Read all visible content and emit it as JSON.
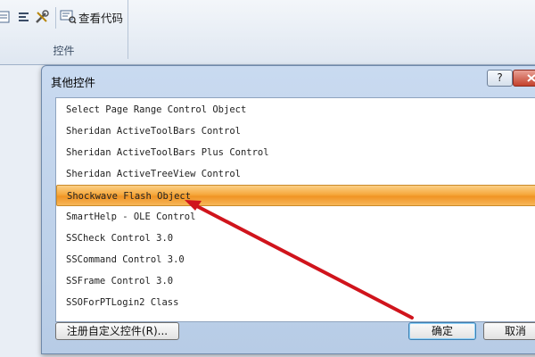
{
  "ribbon": {
    "view_code_label": "查看代码",
    "group_label": "控件",
    "icons": [
      "properties-icon",
      "align-icon",
      "tools-icon",
      "view-code-icon"
    ]
  },
  "dialog": {
    "title": "其他控件",
    "help_label": "?",
    "items": [
      "Select Page Range Control Object",
      "Sheridan ActiveToolBars Control",
      "Sheridan ActiveToolBars Plus Control",
      "Sheridan ActiveTreeView Control",
      "Shockwave Flash Object",
      "SmartHelp - OLE Control",
      "SSCheck Control 3.0",
      "SSCommand Control 3.0",
      "SSFrame Control 3.0",
      "SSOForPTLogin2 Class"
    ],
    "selected_item": "Shockwave Flash Object",
    "register_label": "注册自定义控件(R)...",
    "ok_label": "确定",
    "cancel_label": "取消"
  },
  "colors": {
    "selection": "#f6a93d",
    "annotation_arrow": "#d0141c",
    "dialog_frame": "#b7cce6"
  }
}
